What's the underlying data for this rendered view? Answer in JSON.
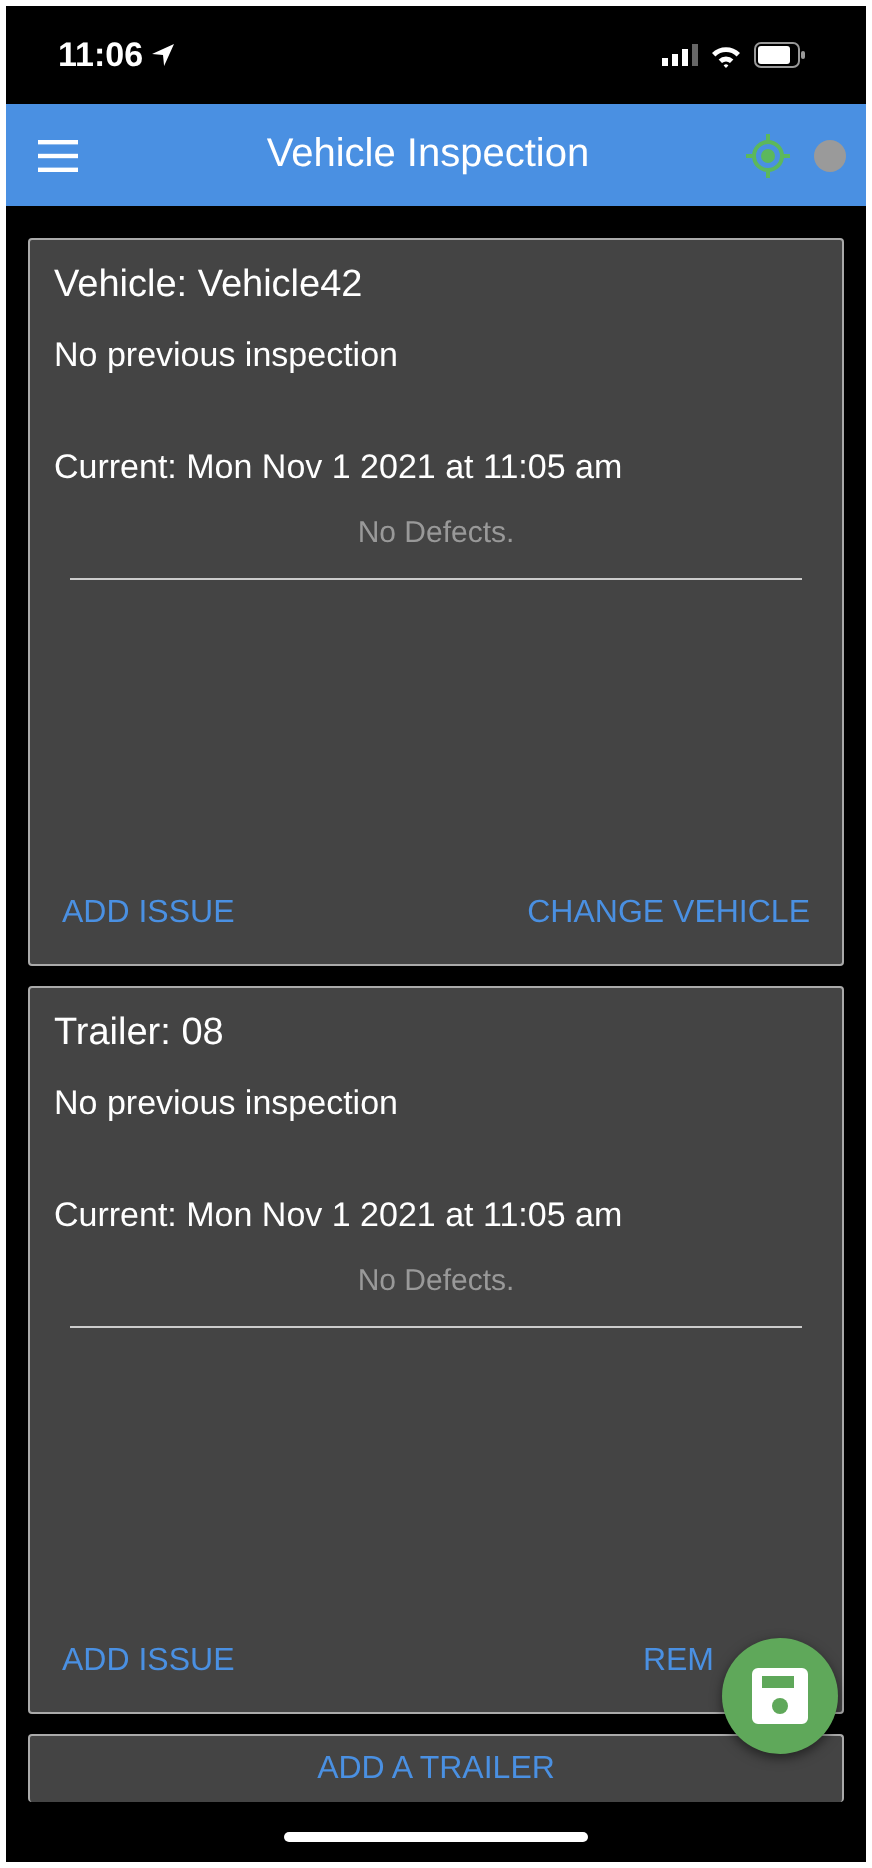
{
  "status_bar": {
    "time": "11:06"
  },
  "app_bar": {
    "title": "Vehicle Inspection"
  },
  "cards": [
    {
      "title": "Vehicle: Vehicle42",
      "previous": "No previous inspection",
      "current": "Current: Mon Nov 1 2021 at 11:05 am",
      "defects": "No Defects.",
      "actions": [
        "ADD ISSUE",
        "CHANGE VEHICLE"
      ]
    },
    {
      "title": "Trailer: 08",
      "previous": "No previous inspection",
      "current": "Current: Mon Nov 1 2021 at 11:05 am",
      "defects": "No Defects.",
      "actions": [
        "ADD ISSUE",
        "REM"
      ]
    }
  ],
  "add_trailer": "ADD A TRAILER"
}
